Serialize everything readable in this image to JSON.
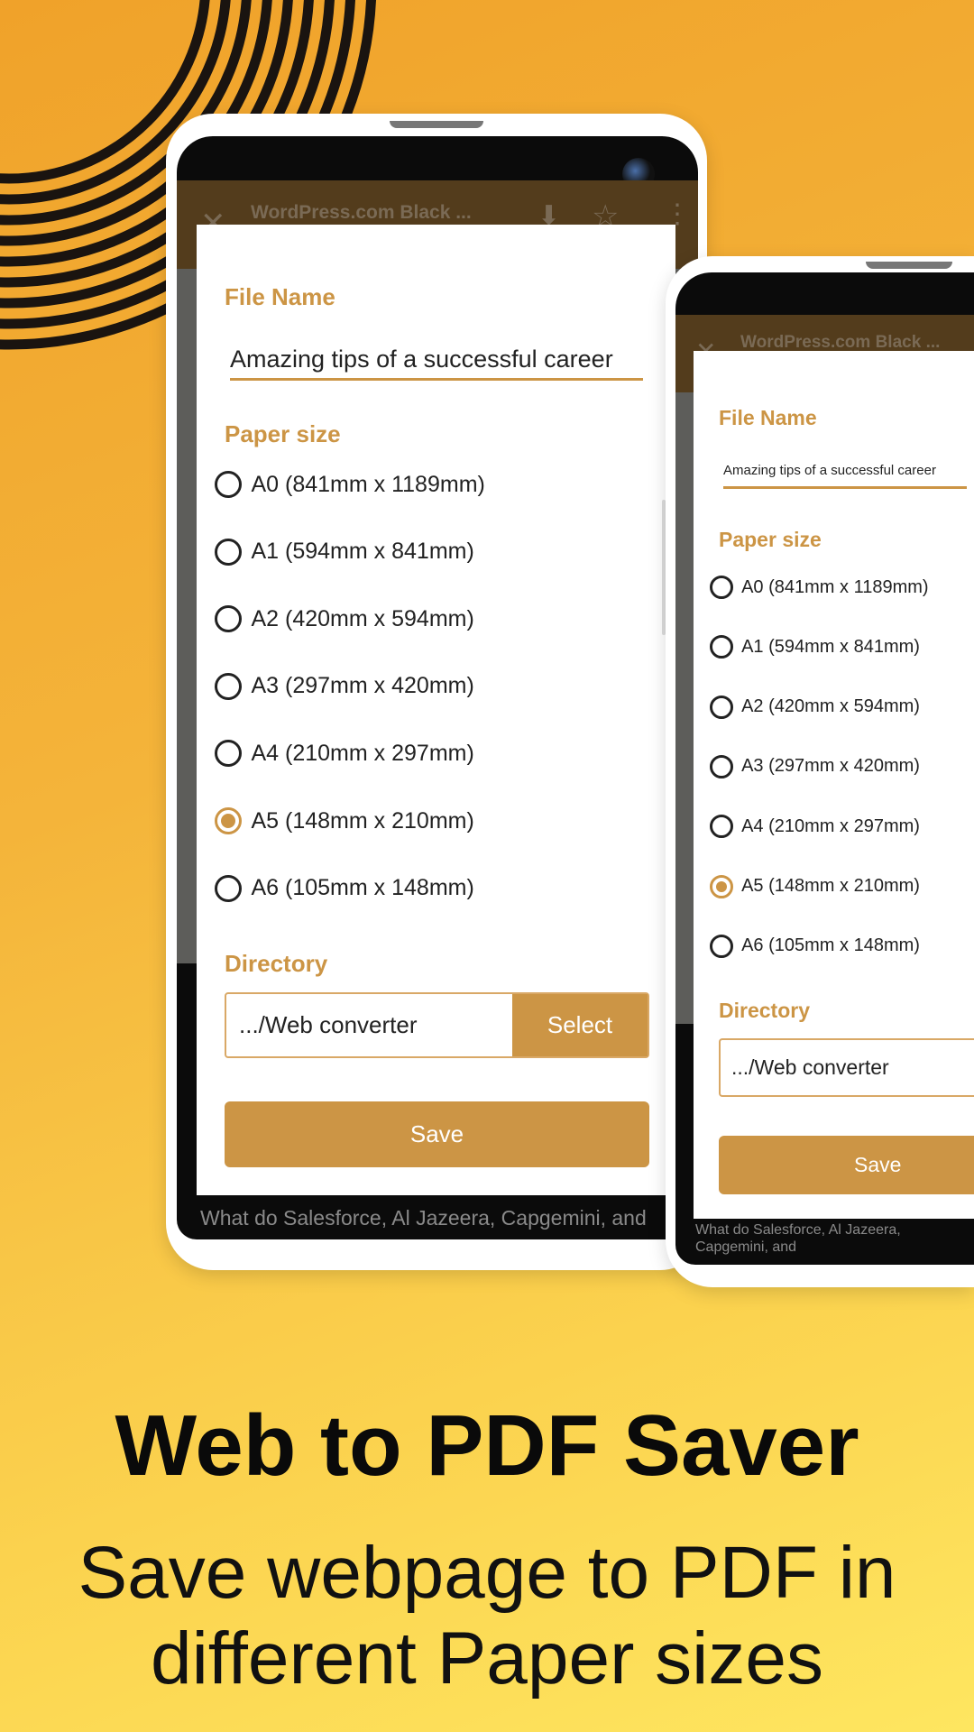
{
  "colors": {
    "accent": "#cc9545",
    "appbar": "#533c1c",
    "bg_start": "#f0a22a",
    "bg_end": "#fee660"
  },
  "hero": {
    "title": "Web to PDF Saver",
    "subtitle_line1": "Save webpage to PDF in",
    "subtitle_line2": "different Paper sizes"
  },
  "app": {
    "page_title": "WordPress.com Black ...",
    "footer_text": "What do Salesforce, Al Jazeera, Capgemini, and",
    "icons": [
      "close-icon",
      "download-icon",
      "star-icon",
      "more-vert-icon"
    ],
    "dialog": {
      "file_name_label": "File Name",
      "file_name_value": "Amazing tips of a successful career",
      "paper_size_label": "Paper size",
      "paper_sizes": [
        {
          "label": "A0 (841mm x 1189mm)",
          "selected": false
        },
        {
          "label": "A1 (594mm x 841mm)",
          "selected": false
        },
        {
          "label": "A2 (420mm x 594mm)",
          "selected": false
        },
        {
          "label": "A3 (297mm x 420mm)",
          "selected": false
        },
        {
          "label": "A4 (210mm x 297mm)",
          "selected": false
        },
        {
          "label": "A5 (148mm x 210mm)",
          "selected": true
        },
        {
          "label": "A6 (105mm x 148mm)",
          "selected": false
        }
      ],
      "directory_label": "Directory",
      "directory_value": ".../Web converter",
      "select_label": "Select",
      "save_label": "Save"
    }
  }
}
